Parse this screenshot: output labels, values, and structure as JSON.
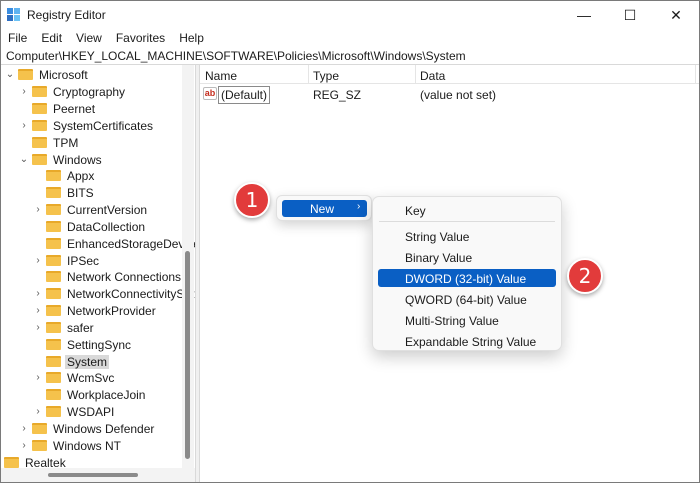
{
  "window": {
    "title": "Registry Editor",
    "minimize_glyph": "—",
    "maximize_glyph": "☐",
    "close_glyph": "✕"
  },
  "menu": [
    "File",
    "Edit",
    "View",
    "Favorites",
    "Help"
  ],
  "address": "Computer\\HKEY_LOCAL_MACHINE\\SOFTWARE\\Policies\\Microsoft\\Windows\\System",
  "tree": [
    {
      "label": "Microsoft",
      "expanded": true
    },
    {
      "label": "Cryptography"
    },
    {
      "label": "Peernet"
    },
    {
      "label": "SystemCertificates"
    },
    {
      "label": "TPM"
    },
    {
      "label": "Windows",
      "expanded": true
    },
    {
      "label": "Appx"
    },
    {
      "label": "BITS"
    },
    {
      "label": "CurrentVersion"
    },
    {
      "label": "DataCollection"
    },
    {
      "label": "EnhancedStorageDevices"
    },
    {
      "label": "IPSec"
    },
    {
      "label": "Network Connections"
    },
    {
      "label": "NetworkConnectivityStat"
    },
    {
      "label": "NetworkProvider"
    },
    {
      "label": "safer"
    },
    {
      "label": "SettingSync"
    },
    {
      "label": "System",
      "selected": true
    },
    {
      "label": "WcmSvc"
    },
    {
      "label": "WorkplaceJoin"
    },
    {
      "label": "WSDAPI"
    },
    {
      "label": "Windows Defender"
    },
    {
      "label": "Windows NT"
    },
    {
      "label": "Realtek"
    }
  ],
  "list": {
    "columns": [
      "Name",
      "Type",
      "Data"
    ],
    "rows": [
      {
        "icon": "string-value-icon",
        "icon_text": "ab",
        "name": "(Default)",
        "type": "REG_SZ",
        "data": "(value not set)"
      }
    ]
  },
  "context_menu": {
    "item": "New",
    "arrow": "›"
  },
  "submenu": {
    "items": [
      "Key",
      "String Value",
      "Binary Value",
      "DWORD (32-bit) Value",
      "QWORD (64-bit) Value",
      "Multi-String Value",
      "Expandable String Value"
    ],
    "highlighted": "DWORD (32-bit) Value"
  },
  "badges": [
    "1",
    "2"
  ],
  "colors": {
    "accent": "#0a5fc4",
    "badge": "#e23b3b",
    "folder": "#f5c24c"
  }
}
